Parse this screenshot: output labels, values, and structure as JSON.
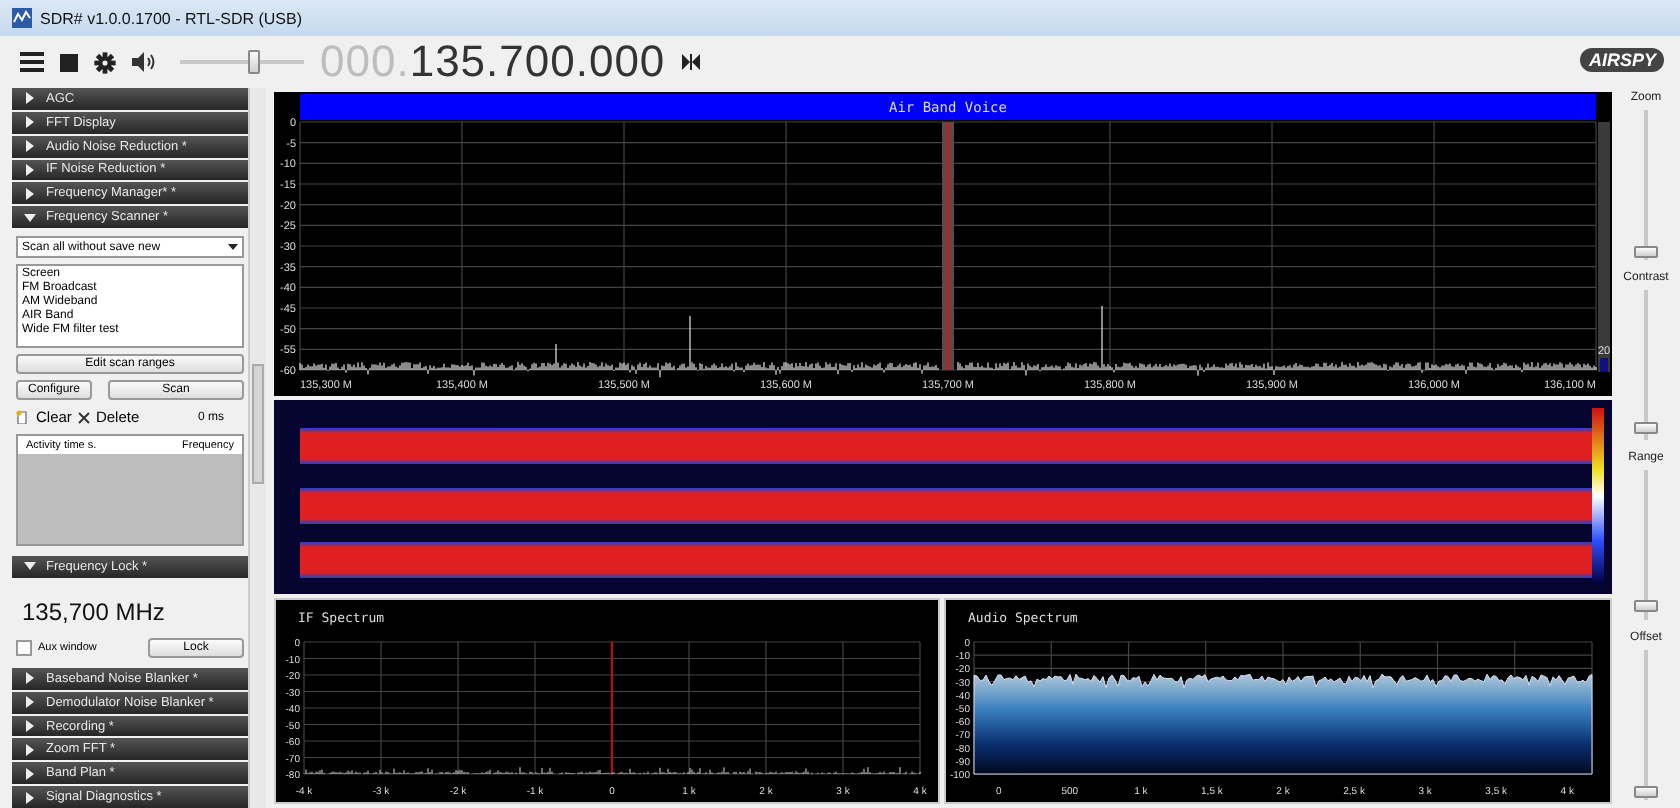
{
  "window": {
    "title": "SDR# v1.0.0.1700 - RTL-SDR (USB)"
  },
  "toolbar": {
    "frequency_prefix": "000.",
    "frequency": "135.700.000",
    "volume": {
      "level": 0.6
    },
    "logo": "AIRSPY"
  },
  "sidebar": [
    {
      "title": "AGC",
      "expanded": false
    },
    {
      "title": "FFT Display",
      "expanded": false
    },
    {
      "title": "Audio Noise Reduction *",
      "expanded": false
    },
    {
      "title": "IF Noise Reduction *",
      "expanded": false
    },
    {
      "title": "Frequency Manager* *",
      "expanded": false
    },
    {
      "title": "Frequency Scanner *",
      "expanded": true,
      "content": {
        "kind": "scanner",
        "mode": "Scan all without save new",
        "ranges": [
          "Screen",
          "FM Broadcast",
          "AM Wideband",
          "AIR Band",
          "Wide FM filter test"
        ],
        "edit_button": "Edit scan ranges",
        "configure_button": "Configure",
        "scan_button": "Scan",
        "clear": "Clear",
        "delete": "Delete",
        "timer": "0 ms",
        "columns": [
          "Activity time s.",
          "Frequency"
        ]
      }
    },
    {
      "title": "Frequency Lock *",
      "expanded": true,
      "content": {
        "kind": "lock",
        "frequency": "135,700 MHz",
        "aux_window": {
          "label": "Aux window",
          "checked": false
        },
        "lock_button": "Lock"
      }
    },
    {
      "title": "Baseband Noise Blanker *",
      "expanded": false
    },
    {
      "title": "Demodulator Noise Blanker *",
      "expanded": false
    },
    {
      "title": "Recording *",
      "expanded": false
    },
    {
      "title": "Zoom FFT *",
      "expanded": false
    },
    {
      "title": "Band Plan *",
      "expanded": false
    },
    {
      "title": "Signal Diagnostics *",
      "expanded": false
    }
  ],
  "spectrum": {
    "title": "Air Band Voice",
    "yticks": [
      "0",
      "-5",
      "-10",
      "-15",
      "-20",
      "-25",
      "-30",
      "-35",
      "-40",
      "-45",
      "-50",
      "-55",
      "-60"
    ],
    "xticks": [
      "135,300 M",
      "135,400 M",
      "135,500 M",
      "135,600 M",
      "135,700 M",
      "135,800 M",
      "135,900 M",
      "136,000 M",
      "136,100 M"
    ],
    "readout": "20"
  },
  "if_spectrum": {
    "title": "IF Spectrum",
    "yticks": [
      "0",
      "-10",
      "-20",
      "-30",
      "-40",
      "-50",
      "-60",
      "-70",
      "-80"
    ],
    "xticks": [
      "-4 k",
      "-3 k",
      "-2 k",
      "-1 k",
      "0",
      "1 k",
      "2 k",
      "3 k",
      "4 k"
    ]
  },
  "audio_spectrum": {
    "title": "Audio Spectrum",
    "yticks": [
      "0",
      "-10",
      "-20",
      "-30",
      "-40",
      "-50",
      "-60",
      "-70",
      "-80",
      "-90",
      "-100"
    ],
    "xticks": [
      "0",
      "500",
      "1 k",
      "1,5 k",
      "2 k",
      "2,5 k",
      "3 k",
      "3,5 k",
      "4 k"
    ]
  },
  "sliders": [
    {
      "label": "Zoom",
      "level": 0.05
    },
    {
      "label": "Contrast",
      "level": 0.08
    },
    {
      "label": "Range",
      "level": 0.1
    },
    {
      "label": "Offset",
      "level": 0.05
    }
  ]
}
